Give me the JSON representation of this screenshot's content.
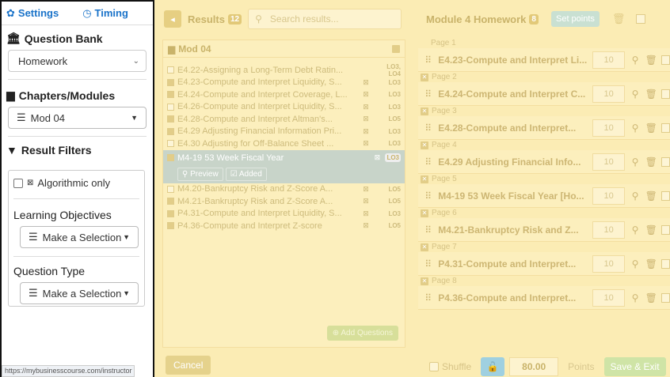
{
  "sidebar": {
    "tab_settings": "Settings",
    "tab_timing": "Timing",
    "question_bank_title": "Question Bank",
    "question_bank_value": "Homework",
    "chapters_title": "Chapters/Modules",
    "chapters_value": "Mod 04",
    "result_filters_title": "Result Filters",
    "algorithmic_label": "Algorithmic only",
    "lo_title": "Learning Objectives",
    "lo_value": "Make a Selection",
    "qtype_title": "Question Type",
    "qtype_value": "Make a Selection",
    "status_url": "https://mybusinesscourse.com/instructor"
  },
  "results": {
    "title": "Results",
    "count": "12",
    "search_placeholder": "Search results...",
    "group_title": "Mod 04",
    "preview_label": "Preview",
    "added_label": "Added",
    "add_questions_label": "Add Questions",
    "cancel_label": "Cancel",
    "rows": [
      {
        "title": "E4.22-Assigning a Long-Term Debt Ratin...",
        "lo": "LO3, LO4",
        "alg": false,
        "checked": false
      },
      {
        "title": "E4.23-Compute and Interpret Liquidity, S...",
        "lo": "LO3",
        "alg": true,
        "checked": true
      },
      {
        "title": "E4.24-Compute and Interpret Coverage, L...",
        "lo": "LO3",
        "alg": true,
        "checked": true
      },
      {
        "title": "E4.26-Compute and Interpret Liquidity, S...",
        "lo": "LO3",
        "alg": true,
        "checked": false
      },
      {
        "title": "E4.28-Compute and Interpret Altman's...",
        "lo": "LO5",
        "alg": true,
        "checked": true
      },
      {
        "title": "E4.29 Adjusting Financial Information Pri...",
        "lo": "LO3",
        "alg": true,
        "checked": true
      },
      {
        "title": "E4.30 Adjusting for Off-Balance Sheet ...",
        "lo": "LO3",
        "alg": true,
        "checked": false
      }
    ],
    "selected_row": {
      "title": "M4-19 53 Week Fiscal Year",
      "lo": "LO3"
    },
    "rows_after": [
      {
        "title": "M4.20-Bankruptcy Risk and Z-Score A...",
        "lo": "LO5",
        "alg": true,
        "checked": false
      },
      {
        "title": "M4.21-Bankruptcy Risk and Z-Score A...",
        "lo": "LO5",
        "alg": true,
        "checked": true
      },
      {
        "title": "P4.31-Compute and Interpret Liquidity, S...",
        "lo": "LO3",
        "alg": true,
        "checked": true
      },
      {
        "title": "P4.36-Compute and Interpret Z-score",
        "lo": "LO5",
        "alg": true,
        "checked": true
      }
    ]
  },
  "module": {
    "title": "Module 4 Homework",
    "count": "8",
    "set_points_label": "Set points",
    "pages": [
      {
        "page": "Page 1",
        "title": "E4.23-Compute and Interpret Li...",
        "points": "10",
        "removable": false
      },
      {
        "page": "Page 2",
        "title": "E4.24-Compute and Interpret C...",
        "points": "10",
        "removable": true
      },
      {
        "page": "Page 3",
        "title": "E4.28-Compute and Interpret...",
        "points": "10",
        "removable": true
      },
      {
        "page": "Page 4",
        "title": "E4.29 Adjusting Financial Info...",
        "points": "10",
        "removable": true
      },
      {
        "page": "Page 5",
        "title": "M4-19 53 Week Fiscal Year [Ho...",
        "points": "10",
        "removable": true
      },
      {
        "page": "Page 6",
        "title": "M4.21-Bankruptcy Risk and Z...",
        "points": "10",
        "removable": true
      },
      {
        "page": "Page 7",
        "title": "P4.31-Compute and Interpret...",
        "points": "10",
        "removable": true
      },
      {
        "page": "Page 8",
        "title": "P4.36-Compute and Interpret...",
        "points": "10",
        "removable": true
      }
    ],
    "shuffle_label": "Shuffle",
    "total_points": "80.00",
    "points_label": "Points",
    "save_exit_label": "Save & Exit"
  }
}
